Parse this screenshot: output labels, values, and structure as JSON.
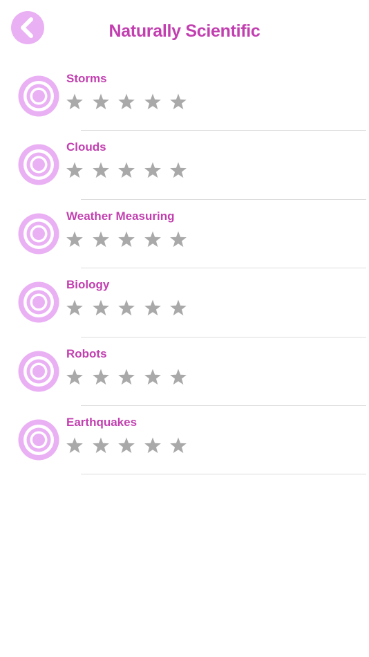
{
  "colors": {
    "accent": "#c23fb0",
    "icon_fill": "#eab0f4",
    "star_empty": "#a9a9a9",
    "divider": "#dcdcdc"
  },
  "header": {
    "back_icon": "chevron-left-icon",
    "title": "Naturally Scientific"
  },
  "topics": [
    {
      "label": "Storms",
      "icon": "target-icon",
      "rating": 0,
      "max_rating": 5
    },
    {
      "label": "Clouds",
      "icon": "target-icon",
      "rating": 0,
      "max_rating": 5
    },
    {
      "label": "Weather Measuring",
      "icon": "target-icon",
      "rating": 0,
      "max_rating": 5
    },
    {
      "label": "Biology",
      "icon": "target-icon",
      "rating": 0,
      "max_rating": 5
    },
    {
      "label": "Robots",
      "icon": "target-icon",
      "rating": 0,
      "max_rating": 5
    },
    {
      "label": "Earthquakes",
      "icon": "target-icon",
      "rating": 0,
      "max_rating": 5
    }
  ]
}
